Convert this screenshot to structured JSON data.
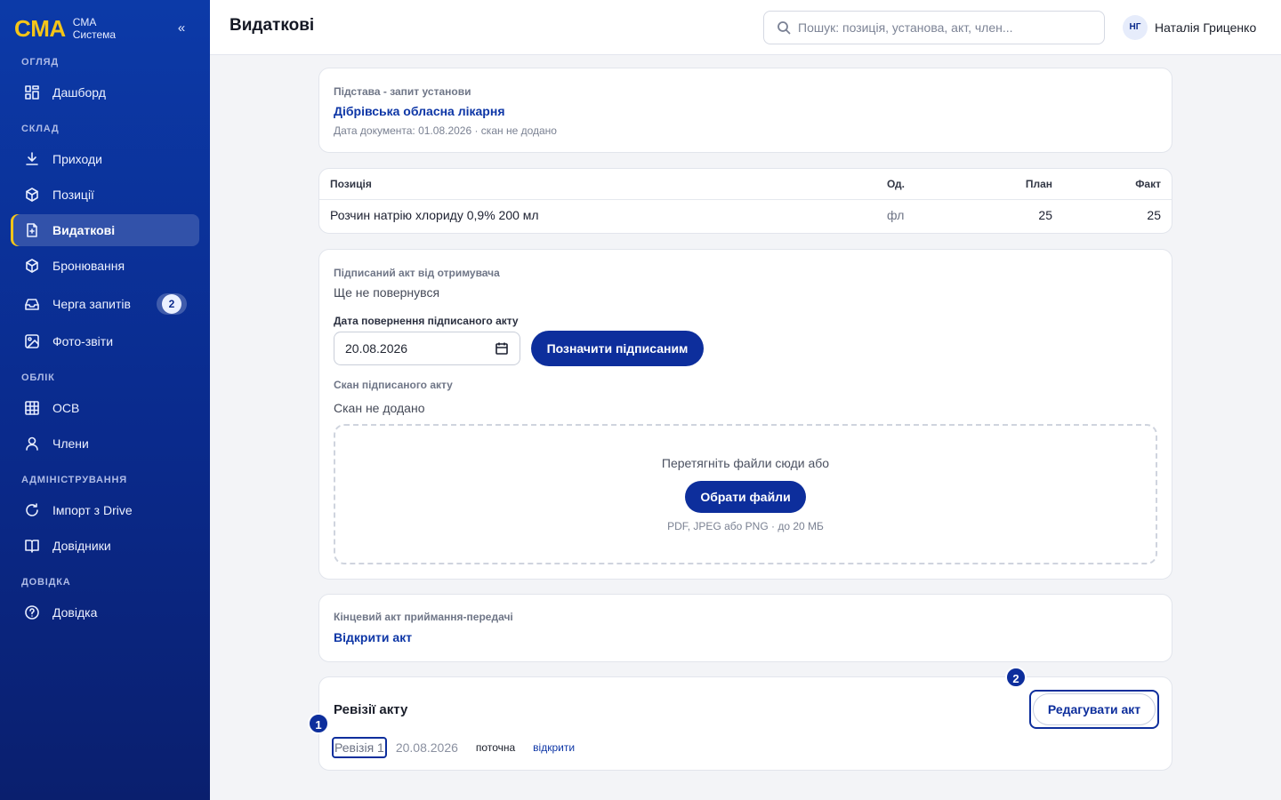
{
  "brand": {
    "logo": "CMA",
    "line1": "CMA",
    "line2": "Система",
    "collapse": "«"
  },
  "nav": {
    "sections": {
      "overview": "ОГЛЯД",
      "warehouse": "СКЛАД",
      "accounting": "ОБЛІК",
      "admin": "АДМІНІСТРУВАННЯ",
      "help": "ДОВІДКА"
    },
    "items": {
      "dashboard": "Дашборд",
      "incoming": "Приходи",
      "positions": "Позиції",
      "outgoing": "Видаткові",
      "booking": "Бронювання",
      "queue": "Черга запитів",
      "queue_badge": "2",
      "photo": "Фото-звіти",
      "osv": "ОСВ",
      "members": "Члени",
      "import": "Імпорт з Drive",
      "refs": "Довідники",
      "help": "Довідка"
    }
  },
  "header": {
    "title": "Видаткові",
    "search_placeholder": "Пошук: позиція, установа, акт, член...",
    "user_initials": "НГ",
    "user_name": "Наталія Гриценко"
  },
  "basis": {
    "label": "Підстава - запит установи",
    "institution": "Дібрівська обласна лікарня",
    "meta": "Дата документа: 01.08.2026 · скан не додано"
  },
  "items_table": {
    "headers": {
      "position": "Позиція",
      "unit": "Од.",
      "plan": "План",
      "fact": "Факт"
    },
    "rows": [
      {
        "position": "Розчин натрію хлориду 0,9% 200 мл",
        "unit": "фл",
        "plan": "25",
        "fact": "25"
      }
    ]
  },
  "signed_act": {
    "label": "Підписаний акт від отримувача",
    "status": "Ще не повернувся",
    "date_label": "Дата повернення підписаного акту",
    "date_value": "20.08.2026",
    "mark_button": "Позначити підписаним",
    "scan_label": "Скан підписаного акту",
    "scan_status": "Скан не додано",
    "drop_text": "Перетягніть файли сюди або",
    "choose_button": "Обрати файли",
    "formats": "PDF, JPEG або PNG · до 20 МБ"
  },
  "final_act": {
    "label": "Кінцевий акт приймання-передачі",
    "open_link": "Відкрити акт"
  },
  "revisions": {
    "title": "Ревізії акту",
    "edit_button": "Редагувати акт",
    "marker_1": "1",
    "marker_2": "2",
    "items": [
      {
        "name": "Ревізія 1",
        "date": "20.08.2026",
        "status": "поточна",
        "open": "відкрити"
      }
    ]
  },
  "colors": {
    "sidebar": "#0c3aa8",
    "accent": "#f5c518",
    "primary": "#0d2e9c"
  }
}
